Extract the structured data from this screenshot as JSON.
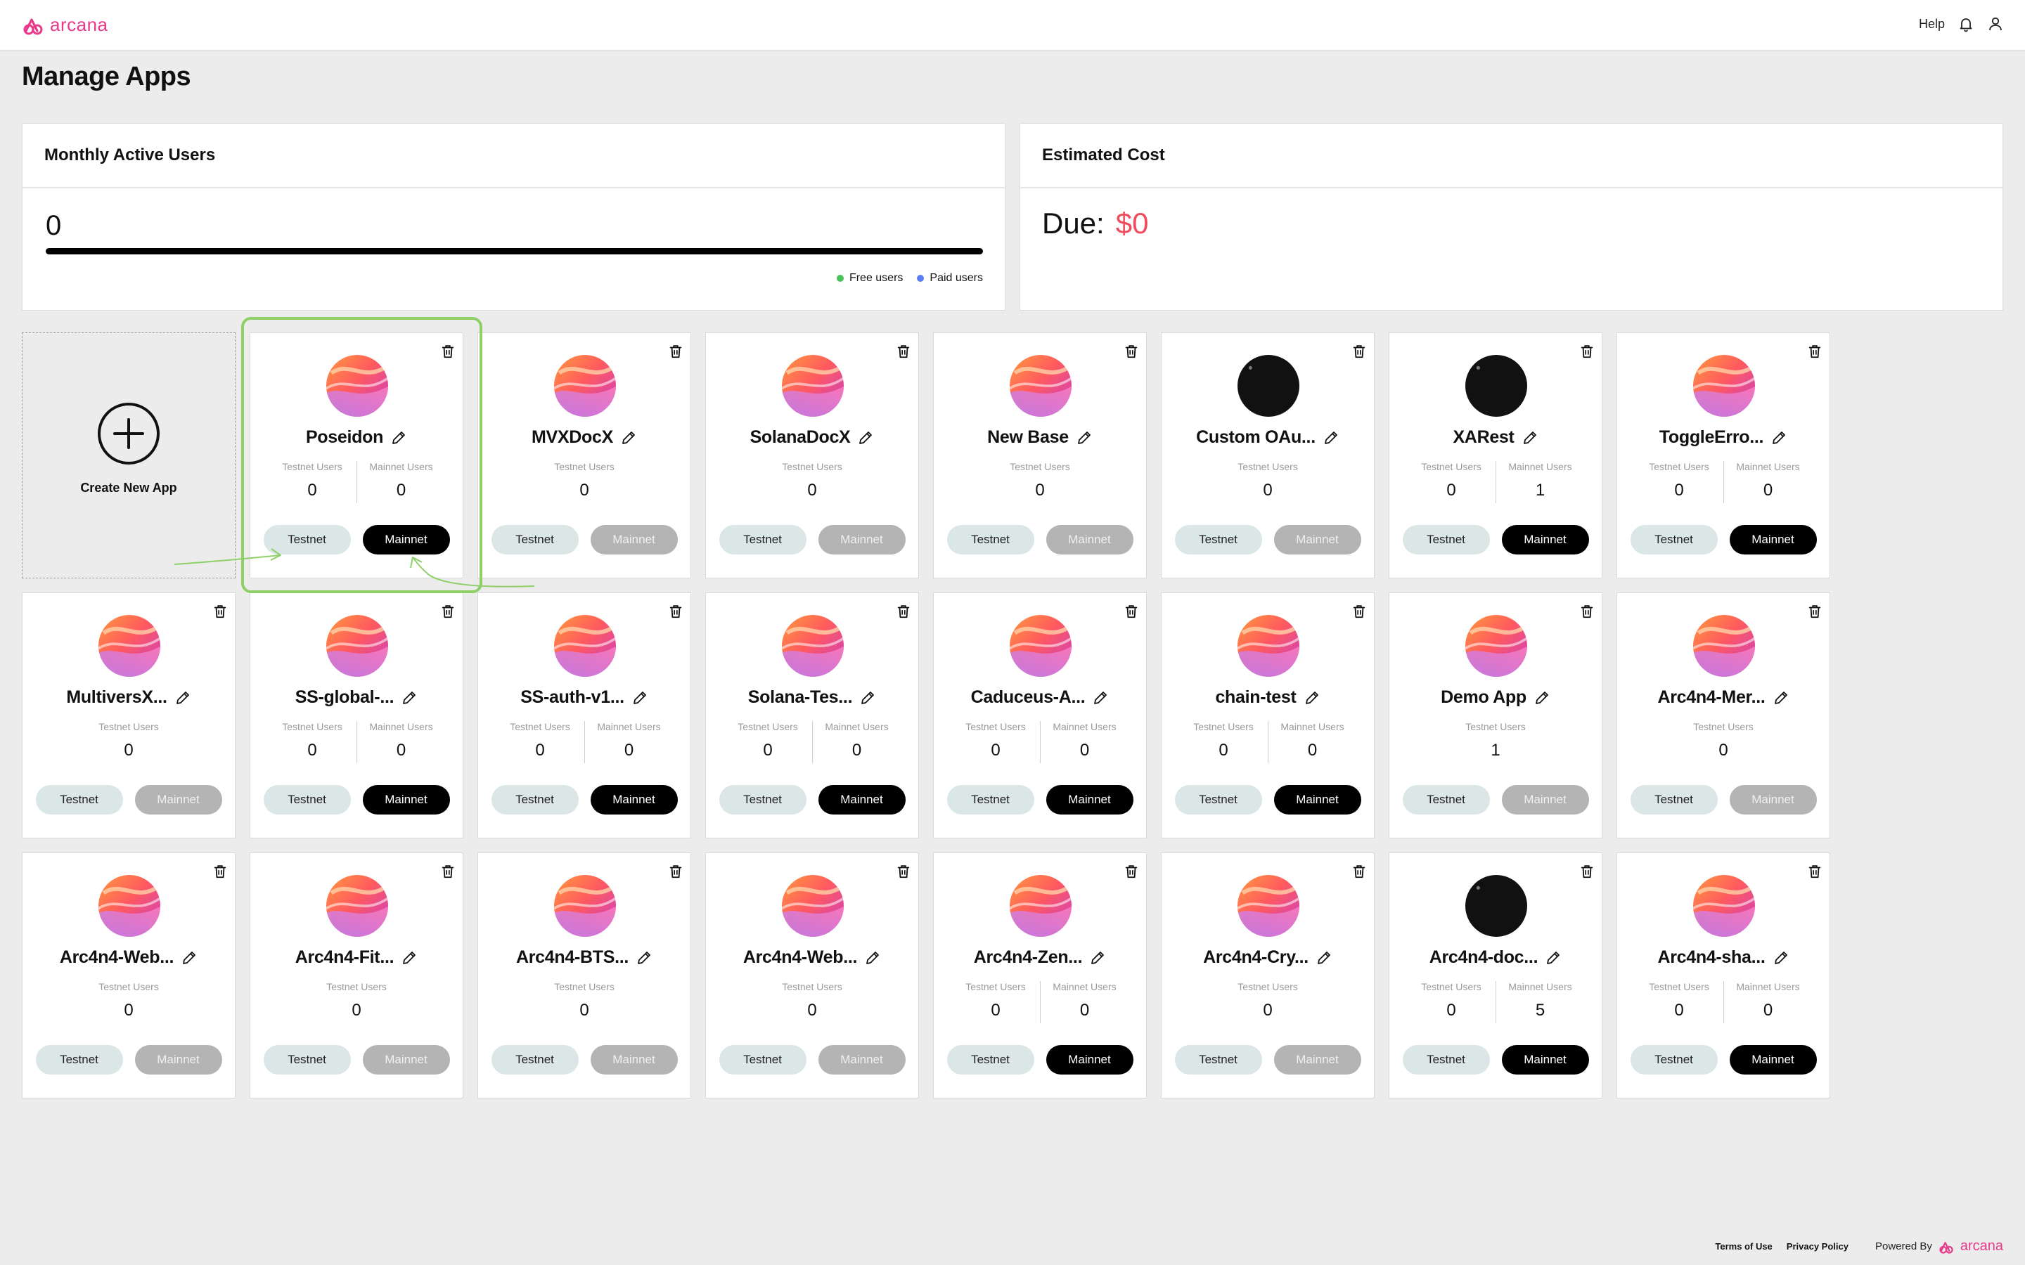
{
  "header": {
    "logo_text": "arcana",
    "help_label": "Help",
    "icons": [
      "bell-icon",
      "user-icon"
    ],
    "accent_color": "#e8398a"
  },
  "page": {
    "title": "Manage Apps"
  },
  "mau_panel": {
    "title": "Monthly Active Users",
    "value": "0",
    "legend": {
      "free": "Free users",
      "paid": "Paid users"
    },
    "free_color": "#4cc35a",
    "paid_color": "#5b7cf6"
  },
  "cost_panel": {
    "title": "Estimated Cost",
    "due_label": "Due:",
    "due_amount": "$0",
    "amount_color": "#ef4d5e"
  },
  "create_app": {
    "label": "Create New App"
  },
  "apps": [
    {
      "name": "Poseidon",
      "avatar": "gradient",
      "testnet_label": "Testnet Users",
      "testnet_users": "0",
      "mainnet_label": "Mainnet Users",
      "mainnet_users": "0",
      "testnet_btn": "Testnet",
      "mainnet_btn": "Mainnet",
      "mainnet_enabled": true
    },
    {
      "name": "MVXDocX",
      "avatar": "gradient",
      "testnet_label": "Testnet Users",
      "testnet_users": "0",
      "testnet_btn": "Testnet",
      "mainnet_btn": "Mainnet",
      "mainnet_enabled": false
    },
    {
      "name": "SolanaDocX",
      "avatar": "gradient",
      "testnet_label": "Testnet Users",
      "testnet_users": "0",
      "testnet_btn": "Testnet",
      "mainnet_btn": "Mainnet",
      "mainnet_enabled": false
    },
    {
      "name": "New Base",
      "avatar": "gradient",
      "testnet_label": "Testnet Users",
      "testnet_users": "0",
      "testnet_btn": "Testnet",
      "mainnet_btn": "Mainnet",
      "mainnet_enabled": false
    },
    {
      "name": "Custom OAu...",
      "avatar": "dark",
      "testnet_label": "Testnet Users",
      "testnet_users": "0",
      "testnet_btn": "Testnet",
      "mainnet_btn": "Mainnet",
      "mainnet_enabled": false
    },
    {
      "name": "XARest",
      "avatar": "dark",
      "testnet_label": "Testnet Users",
      "testnet_users": "0",
      "mainnet_label": "Mainnet Users",
      "mainnet_users": "1",
      "testnet_btn": "Testnet",
      "mainnet_btn": "Mainnet",
      "mainnet_enabled": true
    },
    {
      "name": "ToggleErro...",
      "avatar": "gradient",
      "testnet_label": "Testnet Users",
      "testnet_users": "0",
      "mainnet_label": "Mainnet Users",
      "mainnet_users": "0",
      "testnet_btn": "Testnet",
      "mainnet_btn": "Mainnet",
      "mainnet_enabled": true
    },
    {
      "name": "MultiversX...",
      "avatar": "gradient",
      "testnet_label": "Testnet Users",
      "testnet_users": "0",
      "testnet_btn": "Testnet",
      "mainnet_btn": "Mainnet",
      "mainnet_enabled": false
    },
    {
      "name": "SS-global-...",
      "avatar": "gradient",
      "testnet_label": "Testnet Users",
      "testnet_users": "0",
      "mainnet_label": "Mainnet Users",
      "mainnet_users": "0",
      "testnet_btn": "Testnet",
      "mainnet_btn": "Mainnet",
      "mainnet_enabled": true
    },
    {
      "name": "SS-auth-v1...",
      "avatar": "gradient",
      "testnet_label": "Testnet Users",
      "testnet_users": "0",
      "mainnet_label": "Mainnet Users",
      "mainnet_users": "0",
      "testnet_btn": "Testnet",
      "mainnet_btn": "Mainnet",
      "mainnet_enabled": true
    },
    {
      "name": "Solana-Tes...",
      "avatar": "gradient",
      "testnet_label": "Testnet Users",
      "testnet_users": "0",
      "mainnet_label": "Mainnet Users",
      "mainnet_users": "0",
      "testnet_btn": "Testnet",
      "mainnet_btn": "Mainnet",
      "mainnet_enabled": true
    },
    {
      "name": "Caduceus-A...",
      "avatar": "gradient",
      "testnet_label": "Testnet Users",
      "testnet_users": "0",
      "mainnet_label": "Mainnet Users",
      "mainnet_users": "0",
      "testnet_btn": "Testnet",
      "mainnet_btn": "Mainnet",
      "mainnet_enabled": true
    },
    {
      "name": "chain-test",
      "avatar": "gradient",
      "testnet_label": "Testnet Users",
      "testnet_users": "0",
      "mainnet_label": "Mainnet Users",
      "mainnet_users": "0",
      "testnet_btn": "Testnet",
      "mainnet_btn": "Mainnet",
      "mainnet_enabled": true
    },
    {
      "name": "Demo App",
      "avatar": "gradient",
      "testnet_label": "Testnet Users",
      "testnet_users": "1",
      "testnet_btn": "Testnet",
      "mainnet_btn": "Mainnet",
      "mainnet_enabled": false
    },
    {
      "name": "Arc4n4-Mer...",
      "avatar": "gradient",
      "testnet_label": "Testnet Users",
      "testnet_users": "0",
      "testnet_btn": "Testnet",
      "mainnet_btn": "Mainnet",
      "mainnet_enabled": false
    },
    {
      "name": "Arc4n4-Web...",
      "avatar": "gradient",
      "testnet_label": "Testnet Users",
      "testnet_users": "0",
      "testnet_btn": "Testnet",
      "mainnet_btn": "Mainnet",
      "mainnet_enabled": false
    },
    {
      "name": "Arc4n4-Fit...",
      "avatar": "gradient",
      "testnet_label": "Testnet Users",
      "testnet_users": "0",
      "testnet_btn": "Testnet",
      "mainnet_btn": "Mainnet",
      "mainnet_enabled": false
    },
    {
      "name": "Arc4n4-BTS...",
      "avatar": "gradient",
      "testnet_label": "Testnet Users",
      "testnet_users": "0",
      "testnet_btn": "Testnet",
      "mainnet_btn": "Mainnet",
      "mainnet_enabled": false
    },
    {
      "name": "Arc4n4-Web...",
      "avatar": "gradient",
      "testnet_label": "Testnet Users",
      "testnet_users": "0",
      "testnet_btn": "Testnet",
      "mainnet_btn": "Mainnet",
      "mainnet_enabled": false
    },
    {
      "name": "Arc4n4-Zen...",
      "avatar": "gradient",
      "testnet_label": "Testnet Users",
      "testnet_users": "0",
      "mainnet_label": "Mainnet Users",
      "mainnet_users": "0",
      "testnet_btn": "Testnet",
      "mainnet_btn": "Mainnet",
      "mainnet_enabled": true
    },
    {
      "name": "Arc4n4-Cry...",
      "avatar": "gradient",
      "testnet_label": "Testnet Users",
      "testnet_users": "0",
      "testnet_btn": "Testnet",
      "mainnet_btn": "Mainnet",
      "mainnet_enabled": false
    },
    {
      "name": "Arc4n4-doc...",
      "avatar": "dark",
      "testnet_label": "Testnet Users",
      "testnet_users": "0",
      "mainnet_label": "Mainnet Users",
      "mainnet_users": "5",
      "testnet_btn": "Testnet",
      "mainnet_btn": "Mainnet",
      "mainnet_enabled": true
    },
    {
      "name": "Arc4n4-sha...",
      "avatar": "gradient",
      "testnet_label": "Testnet Users",
      "testnet_users": "0",
      "mainnet_label": "Mainnet Users",
      "mainnet_users": "0",
      "testnet_btn": "Testnet",
      "mainnet_btn": "Mainnet",
      "mainnet_enabled": true
    }
  ],
  "footer": {
    "terms": "Terms of Use",
    "privacy": "Privacy Policy",
    "powered_by": "Powered By",
    "logo_text": "arcana"
  }
}
